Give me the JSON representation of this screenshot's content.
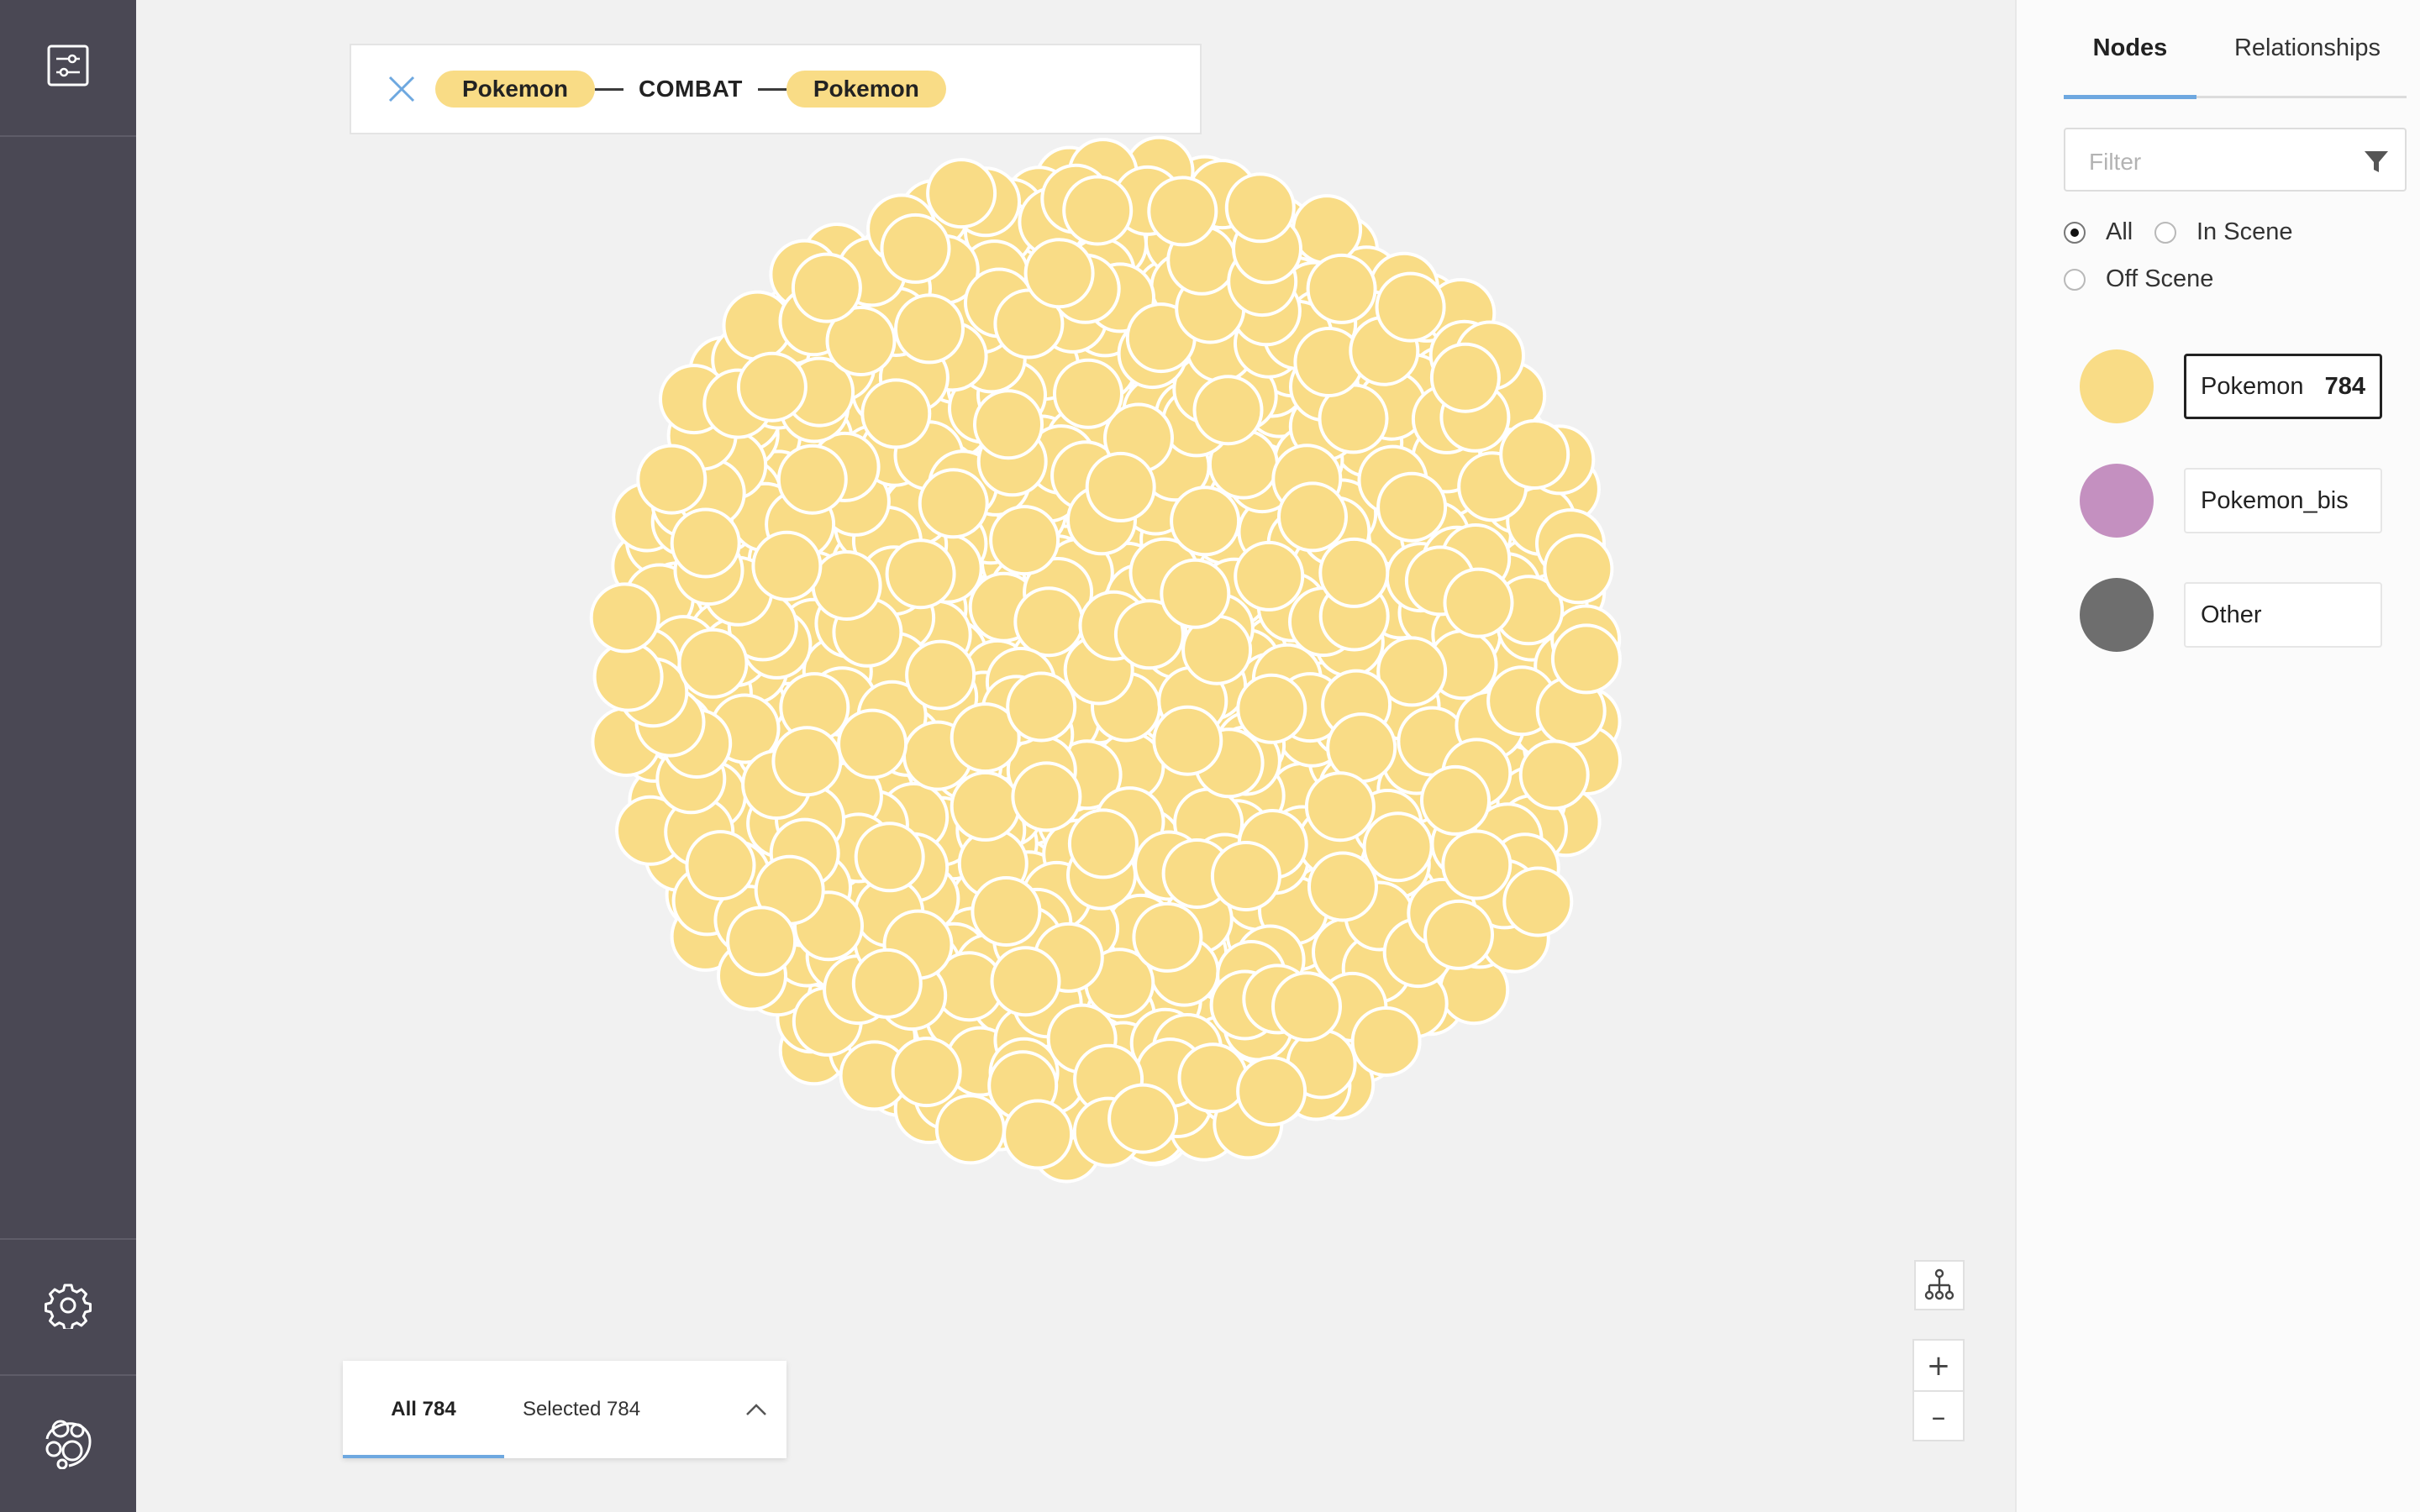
{
  "query": {
    "source_label": "Pokemon",
    "relationship": "COMBAT",
    "target_label": "Pokemon"
  },
  "counter": {
    "all": "All 784",
    "selected": "Selected 784"
  },
  "zoom": {
    "in_symbol": "+",
    "out_symbol": "–"
  },
  "panel": {
    "tabs": [
      "Nodes",
      "Relationships"
    ],
    "active_tab": "Nodes",
    "filter_placeholder": "Filter",
    "filter_value": "",
    "radio_options": [
      "All",
      "In Scene",
      "Off Scene"
    ],
    "radio_selected": "All",
    "legend": [
      {
        "label": "Pokemon",
        "count": "784",
        "color": "#f9dc86",
        "active": true
      },
      {
        "label": "Pokemon_bis",
        "count": "",
        "color": "#c490c0",
        "active": false
      },
      {
        "label": "Other",
        "count": "",
        "color": "#6e6e6e",
        "active": false
      }
    ]
  },
  "graph": {
    "node_count": 784,
    "node_color": "#f9dc86",
    "node_stroke": "#ffffff",
    "edge_color": "#9a9a9a"
  },
  "colors": {
    "sidebar": "#4a4854",
    "canvas": "#f1f1f1",
    "accent": "#6ea8e0",
    "node_fill": "#f9dc86"
  },
  "icons": {
    "sidebar_top": "filter-settings-icon",
    "sidebar_settings": "gear-icon",
    "sidebar_logo": "app-logo-icon",
    "query_close": "close-icon",
    "layout": "hierarchy-layout-icon",
    "filter": "funnel-icon",
    "counter_toggle": "chevron-up-icon"
  }
}
